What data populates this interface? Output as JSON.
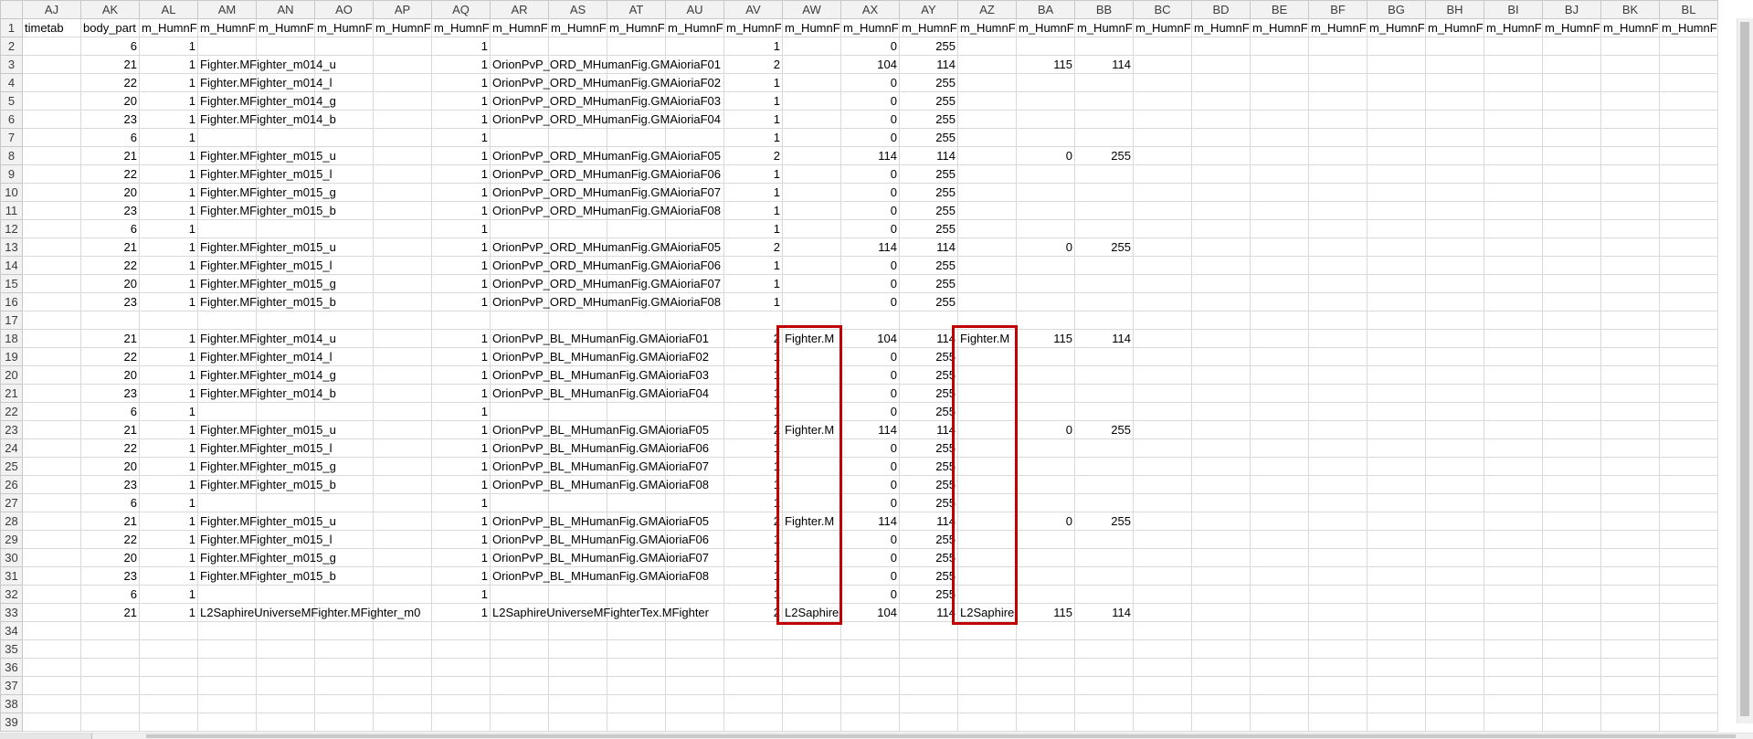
{
  "columns": [
    "AJ",
    "AK",
    "AL",
    "AM",
    "AN",
    "AO",
    "AP",
    "AQ",
    "AR",
    "AS",
    "AT",
    "AU",
    "AV",
    "AW",
    "AX",
    "AY",
    "AZ",
    "BA",
    "BB",
    "BC",
    "BD",
    "BE",
    "BF",
    "BG",
    "BH",
    "BI",
    "BJ",
    "BK",
    "BL"
  ],
  "rows": [
    {
      "n": "1",
      "c": {
        "AJ": "timetab",
        "AK": "body_part",
        "AL": "m_HumnF",
        "AM": "m_HumnF",
        "AN": "m_HumnF",
        "AO": "m_HumnF",
        "AP": "m_HumnF",
        "AQ": "m_HumnF",
        "AR": "m_HumnF",
        "AS": "m_HumnF",
        "AT": "m_HumnF",
        "AU": "m_HumnF",
        "AV": "m_HumnF",
        "AW": "m_HumnF",
        "AX": "m_HumnF",
        "AY": "m_HumnF",
        "AZ": "m_HumnF",
        "BA": "m_HumnF",
        "BB": "m_HumnF",
        "BC": "m_HumnF",
        "BD": "m_HumnF",
        "BE": "m_HumnF",
        "BF": "m_HumnF",
        "BG": "m_HumnF",
        "BH": "m_HumnF",
        "BI": "m_HumnF",
        "BJ": "m_HumnF",
        "BK": "m_HumnF",
        "BL": "m_HumnF"
      }
    },
    {
      "n": "2",
      "c": {
        "AK": "6",
        "AL": "1",
        "AQ": "1",
        "AV": "1",
        "AX": "0",
        "AY": "255"
      }
    },
    {
      "n": "3",
      "c": {
        "AK": "21",
        "AL": "1",
        "AM": "Fighter.MFighter_m014_u",
        "AQ": "1",
        "AR": "OrionPvP_ORD_MHumanFig.GMAioriaF01",
        "AV": "2",
        "AX": "104",
        "AY": "114",
        "BA": "115",
        "BB": "114"
      }
    },
    {
      "n": "4",
      "c": {
        "AK": "22",
        "AL": "1",
        "AM": "Fighter.MFighter_m014_l",
        "AQ": "1",
        "AR": "OrionPvP_ORD_MHumanFig.GMAioriaF02",
        "AV": "1",
        "AX": "0",
        "AY": "255"
      }
    },
    {
      "n": "5",
      "c": {
        "AK": "20",
        "AL": "1",
        "AM": "Fighter.MFighter_m014_g",
        "AQ": "1",
        "AR": "OrionPvP_ORD_MHumanFig.GMAioriaF03",
        "AV": "1",
        "AX": "0",
        "AY": "255"
      }
    },
    {
      "n": "6",
      "c": {
        "AK": "23",
        "AL": "1",
        "AM": "Fighter.MFighter_m014_b",
        "AQ": "1",
        "AR": "OrionPvP_ORD_MHumanFig.GMAioriaF04",
        "AV": "1",
        "AX": "0",
        "AY": "255"
      }
    },
    {
      "n": "7",
      "c": {
        "AK": "6",
        "AL": "1",
        "AQ": "1",
        "AV": "1",
        "AX": "0",
        "AY": "255"
      }
    },
    {
      "n": "8",
      "c": {
        "AK": "21",
        "AL": "1",
        "AM": "Fighter.MFighter_m015_u",
        "AQ": "1",
        "AR": "OrionPvP_ORD_MHumanFig.GMAioriaF05",
        "AV": "2",
        "AX": "114",
        "AY": "114",
        "BA": "0",
        "BB": "255"
      }
    },
    {
      "n": "9",
      "c": {
        "AK": "22",
        "AL": "1",
        "AM": "Fighter.MFighter_m015_l",
        "AQ": "1",
        "AR": "OrionPvP_ORD_MHumanFig.GMAioriaF06",
        "AV": "1",
        "AX": "0",
        "AY": "255"
      }
    },
    {
      "n": "10",
      "c": {
        "AK": "20",
        "AL": "1",
        "AM": "Fighter.MFighter_m015_g",
        "AQ": "1",
        "AR": "OrionPvP_ORD_MHumanFig.GMAioriaF07",
        "AV": "1",
        "AX": "0",
        "AY": "255"
      }
    },
    {
      "n": "11",
      "c": {
        "AK": "23",
        "AL": "1",
        "AM": "Fighter.MFighter_m015_b",
        "AQ": "1",
        "AR": "OrionPvP_ORD_MHumanFig.GMAioriaF08",
        "AV": "1",
        "AX": "0",
        "AY": "255"
      }
    },
    {
      "n": "12",
      "c": {
        "AK": "6",
        "AL": "1",
        "AQ": "1",
        "AV": "1",
        "AX": "0",
        "AY": "255"
      }
    },
    {
      "n": "13",
      "c": {
        "AK": "21",
        "AL": "1",
        "AM": "Fighter.MFighter_m015_u",
        "AQ": "1",
        "AR": "OrionPvP_ORD_MHumanFig.GMAioriaF05",
        "AV": "2",
        "AX": "114",
        "AY": "114",
        "BA": "0",
        "BB": "255"
      }
    },
    {
      "n": "14",
      "c": {
        "AK": "22",
        "AL": "1",
        "AM": "Fighter.MFighter_m015_l",
        "AQ": "1",
        "AR": "OrionPvP_ORD_MHumanFig.GMAioriaF06",
        "AV": "1",
        "AX": "0",
        "AY": "255"
      }
    },
    {
      "n": "15",
      "c": {
        "AK": "20",
        "AL": "1",
        "AM": "Fighter.MFighter_m015_g",
        "AQ": "1",
        "AR": "OrionPvP_ORD_MHumanFig.GMAioriaF07",
        "AV": "1",
        "AX": "0",
        "AY": "255"
      }
    },
    {
      "n": "16",
      "c": {
        "AK": "23",
        "AL": "1",
        "AM": "Fighter.MFighter_m015_b",
        "AQ": "1",
        "AR": "OrionPvP_ORD_MHumanFig.GMAioriaF08",
        "AV": "1",
        "AX": "0",
        "AY": "255"
      }
    },
    {
      "n": "17",
      "c": {}
    },
    {
      "n": "18",
      "c": {
        "AK": "21",
        "AL": "1",
        "AM": "Fighter.MFighter_m014_u",
        "AQ": "1",
        "AR": "OrionPvP_BL_MHumanFig.GMAioriaF01",
        "AV": "2",
        "AW": "Fighter.M",
        "AX": "104",
        "AY": "114",
        "AZ": "Fighter.M",
        "BA": "115",
        "BB": "114"
      }
    },
    {
      "n": "19",
      "c": {
        "AK": "22",
        "AL": "1",
        "AM": "Fighter.MFighter_m014_l",
        "AQ": "1",
        "AR": "OrionPvP_BL_MHumanFig.GMAioriaF02",
        "AV": "1",
        "AX": "0",
        "AY": "255"
      }
    },
    {
      "n": "20",
      "c": {
        "AK": "20",
        "AL": "1",
        "AM": "Fighter.MFighter_m014_g",
        "AQ": "1",
        "AR": "OrionPvP_BL_MHumanFig.GMAioriaF03",
        "AV": "1",
        "AX": "0",
        "AY": "255"
      }
    },
    {
      "n": "21",
      "c": {
        "AK": "23",
        "AL": "1",
        "AM": "Fighter.MFighter_m014_b",
        "AQ": "1",
        "AR": "OrionPvP_BL_MHumanFig.GMAioriaF04",
        "AV": "1",
        "AX": "0",
        "AY": "255"
      }
    },
    {
      "n": "22",
      "c": {
        "AK": "6",
        "AL": "1",
        "AQ": "1",
        "AV": "1",
        "AX": "0",
        "AY": "255"
      }
    },
    {
      "n": "23",
      "c": {
        "AK": "21",
        "AL": "1",
        "AM": "Fighter.MFighter_m015_u",
        "AQ": "1",
        "AR": "OrionPvP_BL_MHumanFig.GMAioriaF05",
        "AV": "2",
        "AW": "Fighter.M",
        "AX": "114",
        "AY": "114",
        "BA": "0",
        "BB": "255"
      }
    },
    {
      "n": "24",
      "c": {
        "AK": "22",
        "AL": "1",
        "AM": "Fighter.MFighter_m015_l",
        "AQ": "1",
        "AR": "OrionPvP_BL_MHumanFig.GMAioriaF06",
        "AV": "1",
        "AX": "0",
        "AY": "255"
      }
    },
    {
      "n": "25",
      "c": {
        "AK": "20",
        "AL": "1",
        "AM": "Fighter.MFighter_m015_g",
        "AQ": "1",
        "AR": "OrionPvP_BL_MHumanFig.GMAioriaF07",
        "AV": "1",
        "AX": "0",
        "AY": "255"
      }
    },
    {
      "n": "26",
      "c": {
        "AK": "23",
        "AL": "1",
        "AM": "Fighter.MFighter_m015_b",
        "AQ": "1",
        "AR": "OrionPvP_BL_MHumanFig.GMAioriaF08",
        "AV": "1",
        "AX": "0",
        "AY": "255"
      }
    },
    {
      "n": "27",
      "c": {
        "AK": "6",
        "AL": "1",
        "AQ": "1",
        "AV": "1",
        "AX": "0",
        "AY": "255"
      }
    },
    {
      "n": "28",
      "c": {
        "AK": "21",
        "AL": "1",
        "AM": "Fighter.MFighter_m015_u",
        "AQ": "1",
        "AR": "OrionPvP_BL_MHumanFig.GMAioriaF05",
        "AV": "2",
        "AW": "Fighter.M",
        "AX": "114",
        "AY": "114",
        "BA": "0",
        "BB": "255"
      }
    },
    {
      "n": "29",
      "c": {
        "AK": "22",
        "AL": "1",
        "AM": "Fighter.MFighter_m015_l",
        "AQ": "1",
        "AR": "OrionPvP_BL_MHumanFig.GMAioriaF06",
        "AV": "1",
        "AX": "0",
        "AY": "255"
      }
    },
    {
      "n": "30",
      "c": {
        "AK": "20",
        "AL": "1",
        "AM": "Fighter.MFighter_m015_g",
        "AQ": "1",
        "AR": "OrionPvP_BL_MHumanFig.GMAioriaF07",
        "AV": "1",
        "AX": "0",
        "AY": "255"
      }
    },
    {
      "n": "31",
      "c": {
        "AK": "23",
        "AL": "1",
        "AM": "Fighter.MFighter_m015_b",
        "AQ": "1",
        "AR": "OrionPvP_BL_MHumanFig.GMAioriaF08",
        "AV": "1",
        "AX": "0",
        "AY": "255"
      }
    },
    {
      "n": "32",
      "c": {
        "AK": "6",
        "AL": "1",
        "AQ": "1",
        "AV": "1",
        "AX": "0",
        "AY": "255"
      }
    },
    {
      "n": "33",
      "c": {
        "AK": "21",
        "AL": "1",
        "AM": "L2SaphireUniverseMFighter.MFighter_m0",
        "AQ": "1",
        "AR": "L2SaphireUniverseMFighterTex.MFighter",
        "AV": "2",
        "AW": "L2Saphire",
        "AX": "104",
        "AY": "114",
        "AZ": "L2Saphire",
        "BA": "115",
        "BB": "114"
      }
    },
    {
      "n": "34",
      "c": {}
    },
    {
      "n": "35",
      "c": {}
    },
    {
      "n": "36",
      "c": {}
    },
    {
      "n": "37",
      "c": {}
    },
    {
      "n": "38",
      "c": {}
    },
    {
      "n": "39",
      "c": {}
    }
  ],
  "annotation_color": "#c00000",
  "highlighted_columns": [
    "AW",
    "AZ"
  ]
}
